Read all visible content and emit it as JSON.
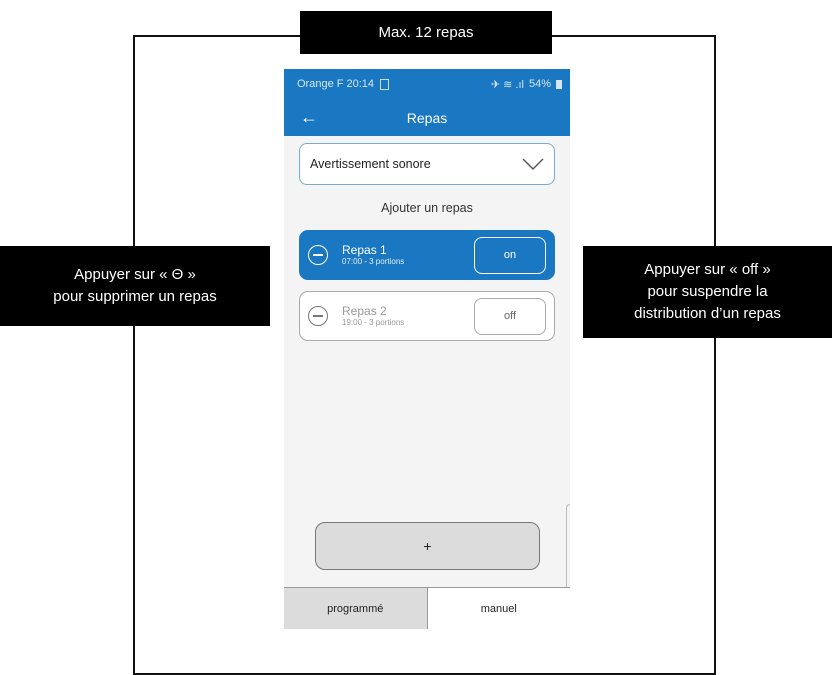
{
  "callouts": {
    "top": "Max. 12 repas",
    "left_line1": "Appuyer sur « Θ »",
    "left_line2": "pour supprimer un repas",
    "right_line1": "Appuyer sur « off »",
    "right_line2": "pour suspendre la",
    "right_line3": "distribution d’un repas"
  },
  "status_bar": {
    "carrier": "Orange F",
    "time": "20:14",
    "indicators": "✈︎ ≋ .ıl",
    "battery": "54%"
  },
  "app_bar": {
    "title": "Repas",
    "back_icon": "arrow-left"
  },
  "dropdown": {
    "selected": "Avertissement sonore",
    "icon": "chevron-down"
  },
  "add_meal_label": "Ajouter un repas",
  "meals": [
    {
      "name": "Repas 1",
      "details": "07:00 - 3 portions",
      "toggle": "on"
    },
    {
      "name": "Repas 2",
      "details": "19:00 - 3 portions",
      "toggle": "off"
    }
  ],
  "add_button_label": "+",
  "tabs": [
    {
      "label": "programmé"
    },
    {
      "label": "manuel"
    }
  ],
  "colors": {
    "primary": "#1a78c2",
    "inactive_border": "#aaaaaa"
  }
}
